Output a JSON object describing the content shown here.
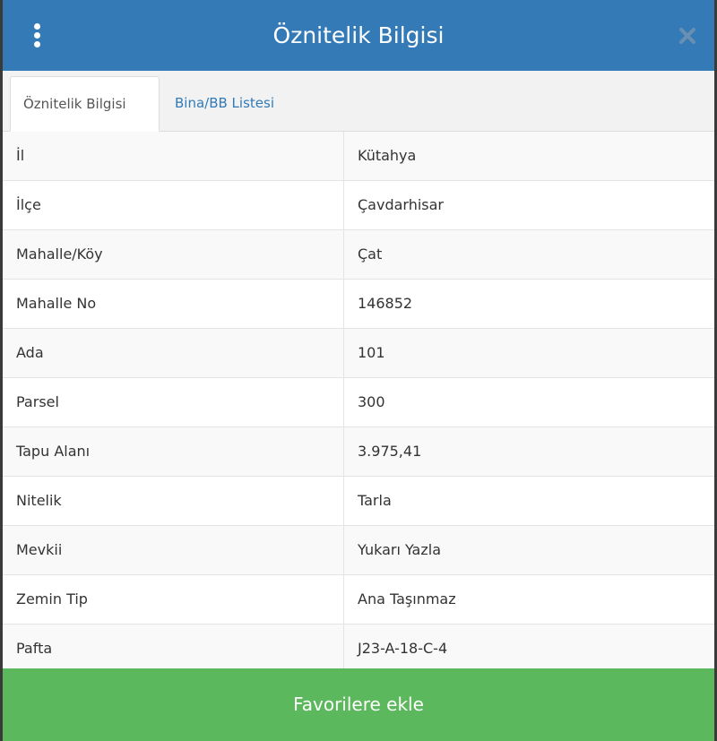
{
  "header": {
    "title": "Öznitelik Bilgisi",
    "menu_icon": "vertical-dots-icon",
    "close_icon": "close-icon",
    "bg_color": "#337ab7"
  },
  "tabs": [
    {
      "label": "Öznitelik Bilgisi",
      "active": true
    },
    {
      "label": "Bina/BB Listesi",
      "active": false
    }
  ],
  "attributes": [
    {
      "label": "İl",
      "value": "Kütahya"
    },
    {
      "label": "İlçe",
      "value": "Çavdarhisar"
    },
    {
      "label": "Mahalle/Köy",
      "value": "Çat"
    },
    {
      "label": "Mahalle No",
      "value": "146852"
    },
    {
      "label": "Ada",
      "value": "101"
    },
    {
      "label": "Parsel",
      "value": "300"
    },
    {
      "label": "Tapu Alanı",
      "value": "3.975,41"
    },
    {
      "label": "Nitelik",
      "value": "Tarla"
    },
    {
      "label": "Mevkii",
      "value": "Yukarı Yazla"
    },
    {
      "label": "Zemin Tip",
      "value": "Ana Taşınmaz"
    },
    {
      "label": "Pafta",
      "value": "J23-A-18-C-4"
    }
  ],
  "footer": {
    "button_label": "Favorilere ekle",
    "button_color": "#5cb85c"
  }
}
